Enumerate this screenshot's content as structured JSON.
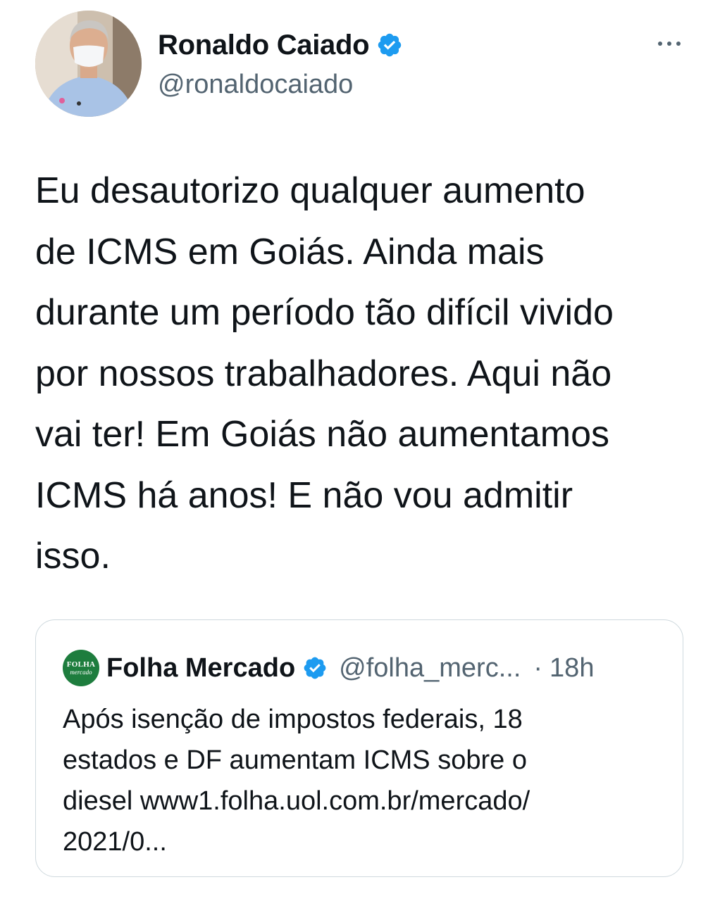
{
  "tweet": {
    "author": {
      "display_name": "Ronaldo Caiado",
      "handle": "@ronaldocaiado",
      "verified": true
    },
    "text": "Eu desautorizo qualquer aumento\nde ICMS em Goiás. Ainda mais\ndurante um período tão difícil vivido\npor nossos trabalhadores. Aqui não\nvai ter! Em Goiás não aumentamos\nICMS há anos! E não vou admitir\nisso."
  },
  "quoted_tweet": {
    "author": {
      "display_name": "Folha Mercado",
      "handle": "@folha_merc...",
      "verified": true,
      "logo_text_top": "FOLHA",
      "logo_text_bottom": "mercado"
    },
    "separator": "·",
    "timestamp": "18h",
    "text": "Após isenção de impostos federais, 18\nestados e DF aumentam ICMS sobre o\ndiesel www1.folha.uol.com.br/mercado/\n2021/0..."
  },
  "icons": {
    "verified": "verified-badge-icon",
    "more": "more-options-icon"
  },
  "colors": {
    "verified_blue": "#1d9bf0",
    "secondary_text": "#536471",
    "border": "#cfd9de",
    "folha_green": "#1e7d3e"
  }
}
